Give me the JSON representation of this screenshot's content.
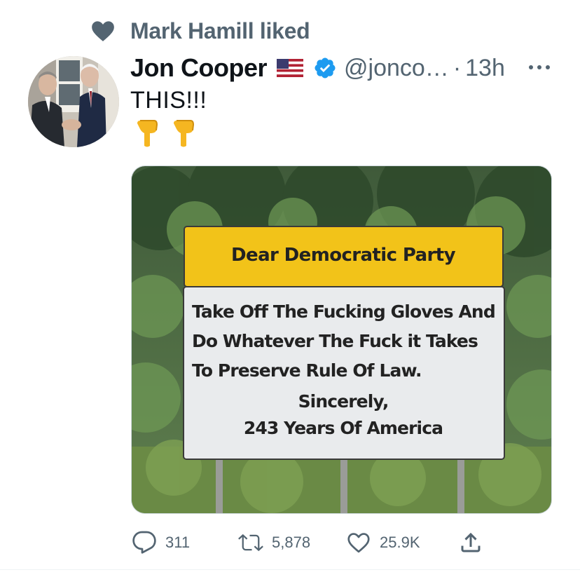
{
  "social_context": {
    "text": "Mark Hamill liked",
    "icon": "heart-icon"
  },
  "tweet": {
    "author_name": "Jon Cooper",
    "flag": "us-flag-emoji",
    "verified": true,
    "handle": "@jonco…",
    "separator": "·",
    "time": "13h",
    "text": "THIS!!!",
    "emojis": [
      "👇",
      "👇"
    ]
  },
  "media": {
    "sign_header": "Dear Democratic Party",
    "sign_lines": [
      "Take Off The Fucking Gloves And",
      "Do Whatever The Fuck it Takes",
      "To Preserve Rule Of Law."
    ],
    "sign_closing": "Sincerely,",
    "sign_signature": "243 Years Of America"
  },
  "actions": {
    "reply_count": "311",
    "retweet_count": "5,878",
    "like_count": "25.9K"
  },
  "colors": {
    "text_primary": "#0f1419",
    "text_secondary": "#536471",
    "verified_blue": "#1d9bf0",
    "sign_yellow": "#f2c319"
  }
}
